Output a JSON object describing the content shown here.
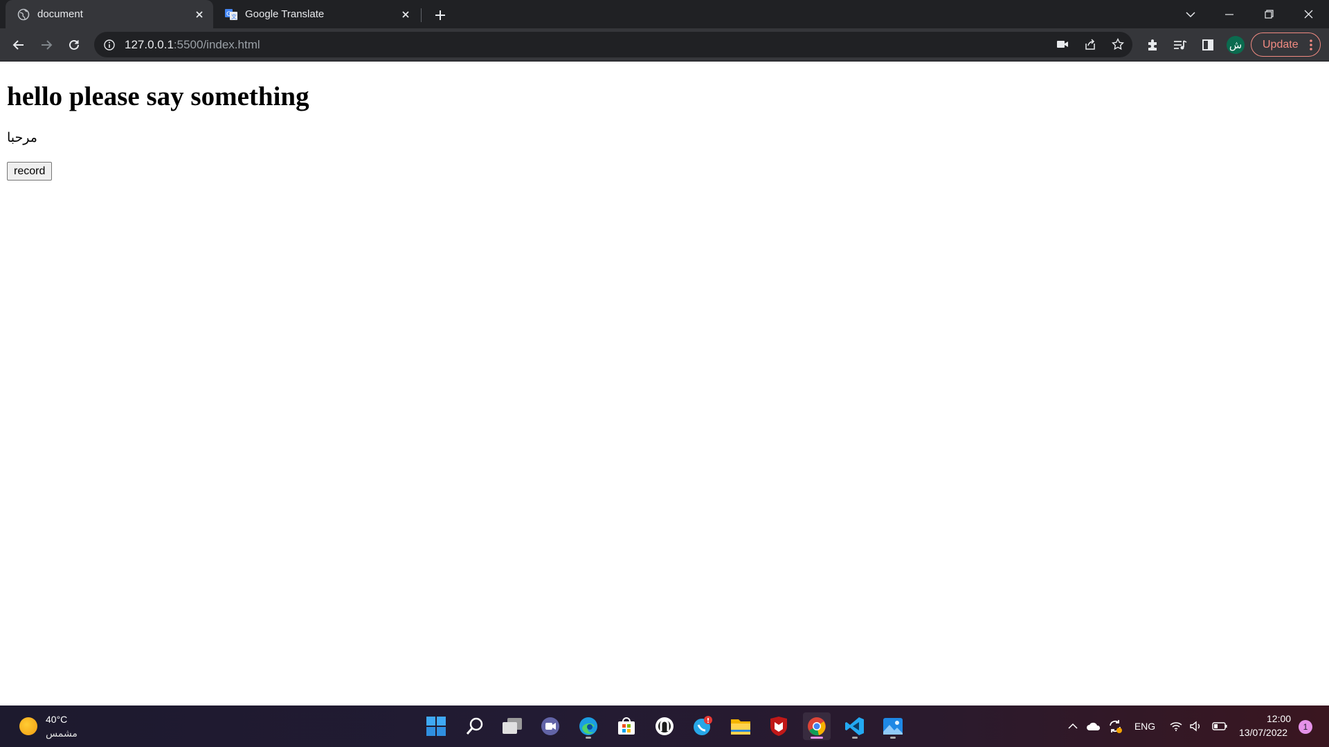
{
  "browser": {
    "tabs": [
      {
        "title": "document",
        "favicon": "globe-icon",
        "active": true
      },
      {
        "title": "Google Translate",
        "favicon": "google-translate-icon",
        "active": false
      }
    ],
    "address": {
      "host": "127.0.0.1",
      "rest": ":5500/index.html"
    },
    "profile_initial": "ش",
    "update_label": "Update"
  },
  "page": {
    "heading": "hello please say something",
    "result_text": "مرحبا",
    "record_label": "record"
  },
  "taskbar": {
    "weather": {
      "temp": "40°C",
      "desc": "مشمس"
    },
    "apps": [
      "start-icon",
      "search-icon",
      "task-view-icon",
      "teams-chat-icon",
      "edge-icon",
      "store-icon",
      "app-icon",
      "whatsapp-icon",
      "file-explorer-icon",
      "mcafee-icon",
      "chrome-icon",
      "vscode-icon",
      "photos-icon"
    ],
    "tray": {
      "language": "ENG"
    },
    "clock": {
      "time": "12:00",
      "date": "13/07/2022"
    },
    "notification_count": "1"
  },
  "colors": {
    "accent_update": "#f28b82",
    "chrome_dark": "#202124",
    "chrome_toolbar": "#35363a"
  }
}
